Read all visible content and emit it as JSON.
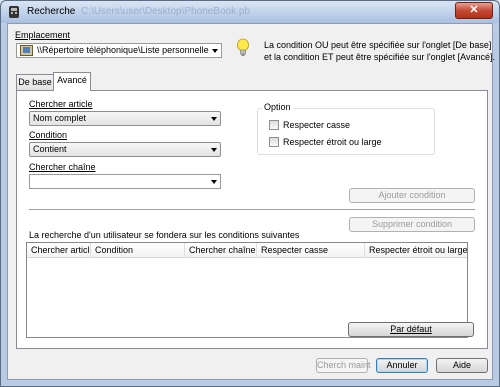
{
  "window": {
    "title": "Recherche",
    "title_path": "C:\\Users\\user\\Desktop\\PhoneBook.pb"
  },
  "emplacement": {
    "label": "Emplacement",
    "value": "\\\\Répertoire téléphonique\\Liste personnelle",
    "icon": "phonebook-icon"
  },
  "hint": {
    "icon": "lightbulb-icon",
    "line1": "La condition OU peut être spécifiée sur l'onglet [De base]",
    "line2": "et la condition ET peut être spécifiée sur l'onglet [Avancé]."
  },
  "tabs": [
    {
      "label": "De base"
    },
    {
      "label": "Avancé",
      "active": true
    }
  ],
  "form": {
    "chercher_article_label": "Chercher article",
    "chercher_article_value": "Nom complet",
    "condition_label": "Condition",
    "condition_value": "Contient",
    "chercher_chaine_label": "Chercher chaîne",
    "chercher_chaine_value": ""
  },
  "option": {
    "title": "Option",
    "respecter_casse": "Respecter casse",
    "respecter_etroit": "Respecter étroit ou large"
  },
  "buttons": {
    "ajouter": "Ajouter condition",
    "supprimer": "Supprimer condition",
    "par_defaut": "Par défaut",
    "chercher": "Cherch maint",
    "annuler": "Annuler",
    "aide": "Aide"
  },
  "conditions": {
    "caption": "La recherche d'un utilisateur se fondera sur les conditions suivantes",
    "columns": [
      "Chercher article",
      "Condition",
      "Chercher chaîne",
      "Respecter casse",
      "Respecter étroit ou large"
    ],
    "rows": []
  }
}
